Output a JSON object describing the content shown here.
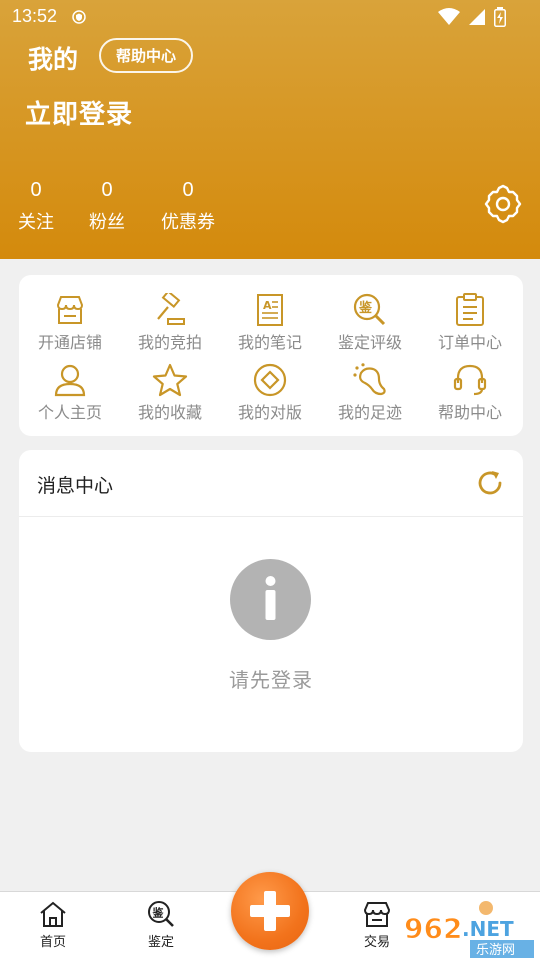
{
  "status_bar": {
    "time": "13:52"
  },
  "header": {
    "title": "我的",
    "help_chip": "帮助中心",
    "login_text": "立即登录",
    "stats": [
      {
        "value": "0",
        "label": "关注"
      },
      {
        "value": "0",
        "label": "粉丝"
      },
      {
        "value": "0",
        "label": "优惠券"
      }
    ]
  },
  "grid": {
    "items": [
      {
        "label": "开通店铺",
        "icon": "store-icon"
      },
      {
        "label": "我的竞拍",
        "icon": "gavel-icon"
      },
      {
        "label": "我的笔记",
        "icon": "notes-icon"
      },
      {
        "label": "鉴定评级",
        "icon": "appraise-icon"
      },
      {
        "label": "订单中心",
        "icon": "clipboard-icon"
      },
      {
        "label": "个人主页",
        "icon": "person-icon"
      },
      {
        "label": "我的收藏",
        "icon": "star-icon"
      },
      {
        "label": "我的对版",
        "icon": "coin-icon"
      },
      {
        "label": "我的足迹",
        "icon": "footprint-icon"
      },
      {
        "label": "帮助中心",
        "icon": "headset-icon"
      }
    ]
  },
  "messages": {
    "title": "消息中心",
    "empty_text": "请先登录"
  },
  "tabbar": {
    "tabs": [
      {
        "label": "首页",
        "icon": "home-icon"
      },
      {
        "label": "鉴定",
        "icon": "appraise-tab-icon"
      },
      {
        "label": "交易",
        "icon": "trade-icon"
      }
    ]
  },
  "watermark": {
    "brand_number": "962",
    "brand_suffix": ".NET",
    "brand_sub": "乐游网"
  },
  "colors": {
    "accent": "#d9a33a",
    "accent_dark": "#d48a0c",
    "icon_gold": "#c89628",
    "fab": "#f2731c"
  }
}
